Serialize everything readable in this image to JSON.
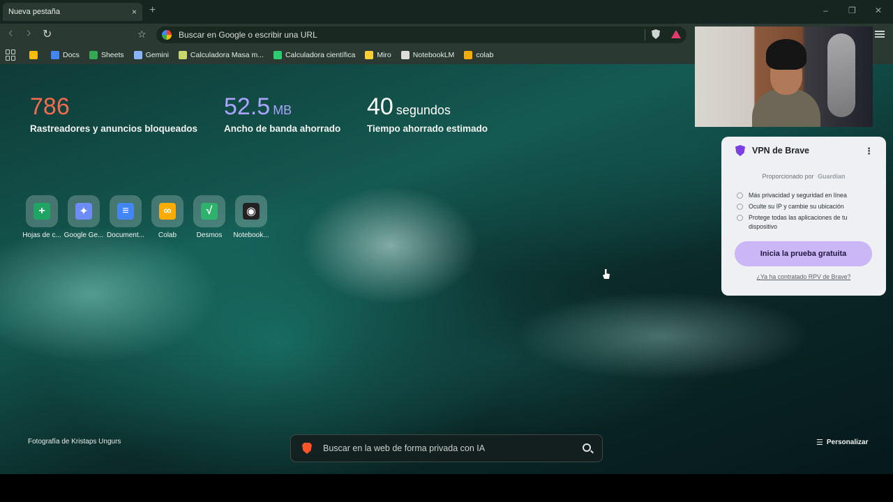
{
  "browser": {
    "tab": {
      "title": "Nueva pestaña",
      "close": "×"
    },
    "new_tab": "+",
    "window_controls": {
      "minimize": "–",
      "maximize": "❐",
      "close": "✕"
    },
    "nav": {
      "back": "‹",
      "forward": "›",
      "reload": "↻",
      "bookmark": "☆"
    },
    "omnibox": {
      "placeholder": "Buscar en Google o escribir una URL"
    },
    "bookmarks": [
      {
        "label": "",
        "icon": "google-drive-icon",
        "color": "#fbbc05"
      },
      {
        "label": "Docs",
        "icon": "docs-icon",
        "color": "#4285f4"
      },
      {
        "label": "Sheets",
        "icon": "sheets-icon",
        "color": "#34a853"
      },
      {
        "label": "Gemini",
        "icon": "gemini-icon",
        "color": "#8ab4f8"
      },
      {
        "label": "Calculadora Masa m...",
        "icon": "calculator-icon",
        "color": "#c8d86a"
      },
      {
        "label": "Calculadora científica",
        "icon": "calculator-icon",
        "color": "#2ecc71"
      },
      {
        "label": "Miro",
        "icon": "miro-icon",
        "color": "#ffd02f"
      },
      {
        "label": "NotebookLM",
        "icon": "notebooklm-icon",
        "color": "#dddddd"
      },
      {
        "label": "colab",
        "icon": "colab-icon",
        "color": "#f9ab00"
      }
    ]
  },
  "stats": [
    {
      "value": "786",
      "unit": "",
      "label": "Rastreadores y anuncios bloqueados",
      "color": "#f26b4f"
    },
    {
      "value": "52.5",
      "unit": "MB",
      "label": "Ancho de banda ahorrado",
      "color": "#a8a4ff"
    },
    {
      "value": "40",
      "unit": "segundos",
      "label": "Tiempo ahorrado estimado",
      "color": "#ffffff"
    }
  ],
  "tiles": [
    {
      "label": "Hojas de c...",
      "glyph": "+",
      "color": "#1fa463"
    },
    {
      "label": "Google Ge...",
      "glyph": "✦",
      "color": "#6d8cf7"
    },
    {
      "label": "Document...",
      "glyph": "≡",
      "color": "#4285f4"
    },
    {
      "label": "Colab",
      "glyph": "∞",
      "color": "#f9ab00"
    },
    {
      "label": "Desmos",
      "glyph": "√",
      "color": "#2fb26b"
    },
    {
      "label": "Notebook...",
      "glyph": "◉",
      "color": "#222222"
    }
  ],
  "photo_credit": "Fotografía de Kristaps Ungurs",
  "customize": {
    "label": "Personalizar",
    "icon": "☰"
  },
  "ai_search": {
    "placeholder": "Buscar en la web de forma privada con IA"
  },
  "vpn": {
    "title": "VPN de Brave",
    "powered_by": "Proporcionado por",
    "powered_brand": "Guardian",
    "features": [
      "Más privacidad y seguridad en línea",
      "Oculte su IP y cambie su ubicación",
      "Protege todas las aplicaciones de tu dispositivo"
    ],
    "cta": "Inicia la prueba gratuita",
    "link": "¿Ya ha contratado RPV de Brave?"
  }
}
